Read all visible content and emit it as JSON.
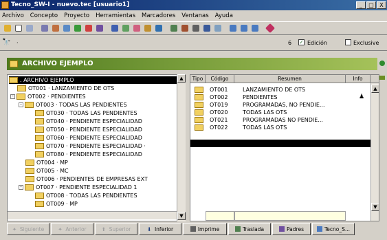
{
  "window": {
    "title": "Tecno_SW-I - nuevo.tec  [usuario1]",
    "min": "_",
    "max": "□",
    "close": "X"
  },
  "menu": [
    "Archivo",
    "Concepto",
    "Proyecto",
    "Herramientas",
    "Marcadores",
    "Ventanas",
    "Ayuda"
  ],
  "secbar": {
    "binoculars": "🔭",
    "count": "6",
    "edicion": "Edición",
    "exclusive": "Exclusive"
  },
  "header": {
    "title": "ARCHIVO EJEMPLO"
  },
  "tree": [
    {
      "label": ". ARCHIVO EJEMPLO"
    },
    {
      "label": "OT001 · LANZAMIENTO DE OTS"
    },
    {
      "label": "OT002 · PENDIENTES"
    },
    {
      "label": "OT003 · TODAS LAS PENDIENTES"
    },
    {
      "label": "OT030 · TODAS LAS PENDIENTES"
    },
    {
      "label": "OT040 · PENDIENTE ESPECIALIDAD"
    },
    {
      "label": "OT050 · PENDIENTE ESPECIALIDAD"
    },
    {
      "label": "OT060 · PENDIENTE ESPECIALIDAD"
    },
    {
      "label": "OT070 · PENDIENTE ESPECIALIDAD ·"
    },
    {
      "label": "OT080 · PENDIENTE ESPECIALIDAD"
    },
    {
      "label": "OT004 · MP"
    },
    {
      "label": "OT005 · MC"
    },
    {
      "label": "OT006 · PENDIENTES DE EMPRESAS EXT"
    },
    {
      "label": "OT007 · PENDIENTE ESPECIALIDAD 1"
    },
    {
      "label": "OT008 · TODAS LAS PENDIENTES"
    },
    {
      "label": "OT009 · MP"
    }
  ],
  "grid": {
    "headers": {
      "tipo": "Tipo",
      "codigo": "Código",
      "resumen": "Resumen",
      "info": "Info"
    },
    "rows": [
      {
        "codigo": "OT001",
        "resumen": "LANZAMIENTO DE OTS"
      },
      {
        "codigo": "OT002",
        "resumen": "PENDIENTES"
      },
      {
        "codigo": "OT019",
        "resumen": "PROGRAMADAS, NO PENDIE..."
      },
      {
        "codigo": "OT020",
        "resumen": "TODAS LAS OTS"
      },
      {
        "codigo": "OT021",
        "resumen": "PROGRAMADAS NO PENDIE..."
      },
      {
        "codigo": "OT022",
        "resumen": "TODAS LAS OTS"
      }
    ]
  },
  "footer": {
    "siguiente": "Siguiente",
    "anterior": "Anterior",
    "superior": "Superior",
    "inferior": "Inferior",
    "imprime": "Imprime",
    "traslada": "Traslada",
    "padres": "Padres",
    "tecno": "Tecno_S..."
  },
  "colors": {
    "header": "#6b8e23",
    "titlebar": "#0a246a",
    "folder": "#f1d060"
  }
}
